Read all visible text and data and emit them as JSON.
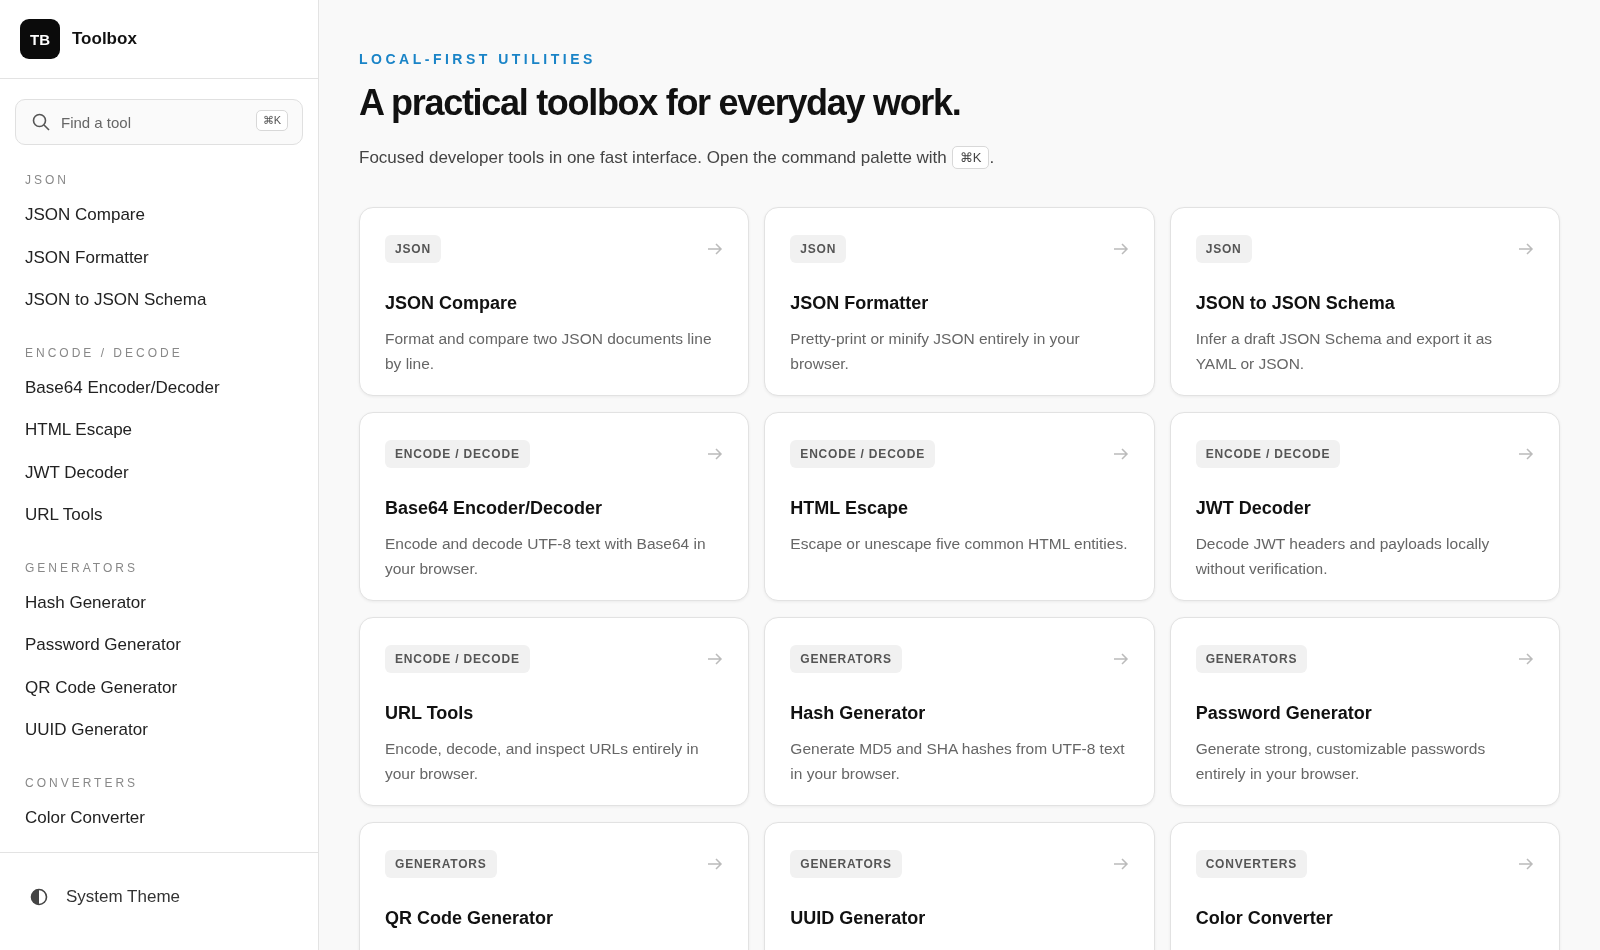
{
  "brand": {
    "logo": "TB",
    "name": "Toolbox"
  },
  "search": {
    "placeholder": "Find a tool",
    "shortcut": "⌘K"
  },
  "sidebar": {
    "groups": [
      {
        "label": "JSON",
        "items": [
          "JSON Compare",
          "JSON Formatter",
          "JSON to JSON Schema"
        ]
      },
      {
        "label": "ENCODE / DECODE",
        "items": [
          "Base64 Encoder/Decoder",
          "HTML Escape",
          "JWT Decoder",
          "URL Tools"
        ]
      },
      {
        "label": "GENERATORS",
        "items": [
          "Hash Generator",
          "Password Generator",
          "QR Code Generator",
          "UUID Generator"
        ]
      },
      {
        "label": "CONVERTERS",
        "items": [
          "Color Converter"
        ]
      }
    ],
    "footer": {
      "label": "System Theme"
    }
  },
  "hero": {
    "eyebrow": "LOCAL-FIRST UTILITIES",
    "title": "A practical toolbox for everyday work.",
    "subtitle": "Focused developer tools in one fast interface. Open the command palette with",
    "shortcut": "⌘K",
    "end": "."
  },
  "cards": [
    {
      "tag": "JSON",
      "title": "JSON Compare",
      "description": "Format and compare two JSON documents line by line."
    },
    {
      "tag": "JSON",
      "title": "JSON Formatter",
      "description": "Pretty-print or minify JSON entirely in your browser."
    },
    {
      "tag": "JSON",
      "title": "JSON to JSON Schema",
      "description": "Infer a draft JSON Schema and export it as YAML or JSON."
    },
    {
      "tag": "ENCODE / DECODE",
      "title": "Base64 Encoder/Decoder",
      "description": "Encode and decode UTF-8 text with Base64 in your browser."
    },
    {
      "tag": "ENCODE / DECODE",
      "title": "HTML Escape",
      "description": "Escape or unescape five common HTML entities."
    },
    {
      "tag": "ENCODE / DECODE",
      "title": "JWT Decoder",
      "description": "Decode JWT headers and payloads locally without verification."
    },
    {
      "tag": "ENCODE / DECODE",
      "title": "URL Tools",
      "description": "Encode, decode, and inspect URLs entirely in your browser."
    },
    {
      "tag": "GENERATORS",
      "title": "Hash Generator",
      "description": "Generate MD5 and SHA hashes from UTF-8 text in your browser."
    },
    {
      "tag": "GENERATORS",
      "title": "Password Generator",
      "description": "Generate strong, customizable passwords entirely in your browser."
    },
    {
      "tag": "GENERATORS",
      "title": "QR Code Generator"
    },
    {
      "tag": "GENERATORS",
      "title": "UUID Generator"
    },
    {
      "tag": "CONVERTERS",
      "title": "Color Converter"
    }
  ]
}
